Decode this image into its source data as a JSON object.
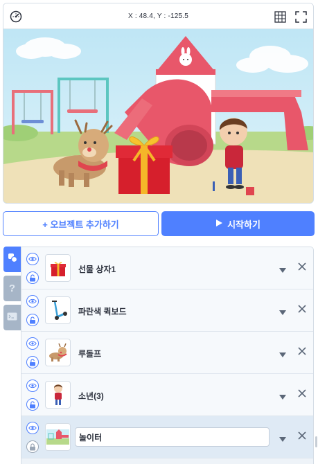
{
  "stage": {
    "coordinates": "X : 48.4, Y : -125.5",
    "icons": {
      "speed": "speedometer-icon",
      "grid": "grid-icon",
      "fullscreen": "fullscreen-icon"
    }
  },
  "buttons": {
    "add_object": "+ 오브젝트 추가하기",
    "start": "시작하기"
  },
  "side_tabs": {
    "help": "?"
  },
  "objects": [
    {
      "name": "선물 상자1",
      "thumb": "gift-box"
    },
    {
      "name": "파란색 퀵보드",
      "thumb": "blue-scooter"
    },
    {
      "name": "루돌프",
      "thumb": "reindeer"
    },
    {
      "name": "소년(3)",
      "thumb": "boy"
    },
    {
      "name": "놀이터",
      "thumb": "playground",
      "selected": true,
      "locked": true,
      "editing": true
    }
  ],
  "colors": {
    "accent": "#4f80ff",
    "tab_inactive": "#a6b5c7"
  }
}
